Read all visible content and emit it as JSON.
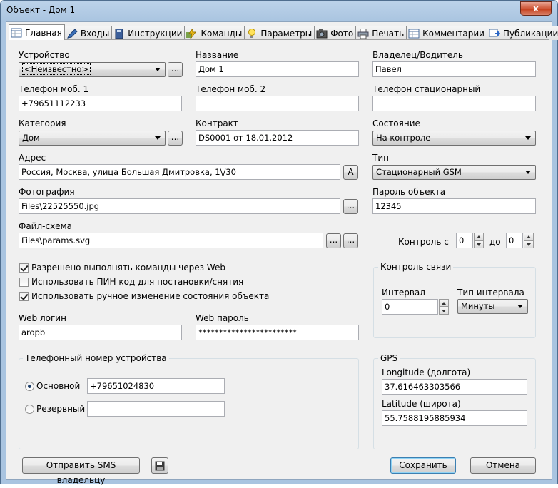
{
  "window": {
    "title": "Объект - Дом 1",
    "close": "x"
  },
  "tabs": [
    {
      "label": "Главная",
      "icon": "table-icon"
    },
    {
      "label": "Входы",
      "icon": "pen-icon"
    },
    {
      "label": "Инструкции",
      "icon": "book-icon"
    },
    {
      "label": "Команды",
      "icon": "lightning-icon"
    },
    {
      "label": "Параметры",
      "icon": "bulb-icon"
    },
    {
      "label": "Фото",
      "icon": "camera-icon"
    },
    {
      "label": "Печать",
      "icon": "printer-icon"
    },
    {
      "label": "Комментарии",
      "icon": "table-icon"
    },
    {
      "label": "Публикации",
      "icon": "publish-icon"
    }
  ],
  "form": {
    "device": {
      "label": "Устройство",
      "value": "<Неизвестно>",
      "browse": "..."
    },
    "name": {
      "label": "Название",
      "value": "Дом 1"
    },
    "owner": {
      "label": "Владелец/Водитель",
      "value": "Павел"
    },
    "mobile1": {
      "label": "Телефон моб. 1",
      "value": "+79651112233"
    },
    "mobile2": {
      "label": "Телефон моб. 2",
      "value": ""
    },
    "landline": {
      "label": "Телефон стационарный",
      "value": ""
    },
    "category": {
      "label": "Категория",
      "value": "Дом",
      "browse": "..."
    },
    "contract": {
      "label": "Контракт",
      "value": "DS0001 от 18.01.2012"
    },
    "state": {
      "label": "Состояние",
      "value": "На контроле"
    },
    "address": {
      "label": "Адрес",
      "value": "Россия, Москва, улица Большая Дмитровка, 1\\/30",
      "button": "A"
    },
    "type": {
      "label": "Тип",
      "value": "Стационарный GSM"
    },
    "photo": {
      "label": "Фотография",
      "value": "Files\\22525550.jpg",
      "browse": "..."
    },
    "password": {
      "label": "Пароль объекта",
      "value": "12345"
    },
    "scheme": {
      "label": "Файл-схема",
      "value": "Files\\params.svg",
      "browse1": "...",
      "browse2": "..."
    },
    "control": {
      "label_from": "Контроль с",
      "from": "0",
      "label_to": "до",
      "to": "0"
    },
    "checks": [
      {
        "label": "Разрешено выполнять команды через Web",
        "checked": true
      },
      {
        "label": "Использовать ПИН код для постановки/снятия",
        "checked": false
      },
      {
        "label": "Использовать ручное изменение состояния объекта",
        "checked": true
      }
    ],
    "link": {
      "title": "Контроль связи",
      "interval_label": "Интервал",
      "interval": "0",
      "type_label": "Тип интервала",
      "type": "Минуты"
    },
    "web_login": {
      "label": "Web логин",
      "value": "aropb"
    },
    "web_password": {
      "label": "Web пароль",
      "value": "************************"
    },
    "phone_group": {
      "title": "Телефонный номер устройства",
      "primary_label": "Основной",
      "primary": "+79651024830",
      "backup_label": "Резервный",
      "backup": ""
    },
    "gps": {
      "title": "GPS",
      "lon_label": "Longitude (долгота)",
      "lon": "37.616463303566",
      "lat_label": "Latitude (широта)",
      "lat": "55.7588195885934"
    }
  },
  "footer": {
    "sms": "Отправить SMS владельцу",
    "save": "Сохранить",
    "cancel": "Отмена"
  }
}
